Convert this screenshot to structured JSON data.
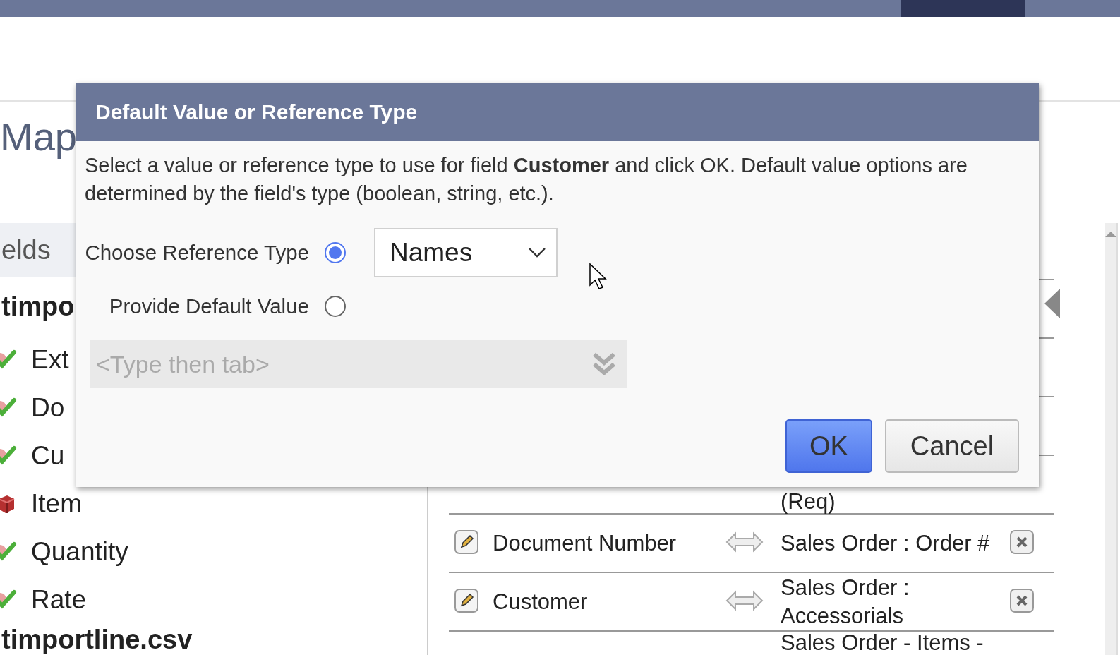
{
  "page": {
    "heading": "Map"
  },
  "fields_panel": {
    "header": "elds",
    "files": [
      {
        "name": "timpo",
        "fields": [
          {
            "label": "Ext",
            "mapped": true
          },
          {
            "label": "Do",
            "mapped": true
          },
          {
            "label": "Cu",
            "mapped": true
          },
          {
            "label": "Item",
            "mapped": false
          },
          {
            "label": "Quantity",
            "mapped": true
          },
          {
            "label": "Rate",
            "mapped": true
          }
        ]
      },
      {
        "name": "timportline.csv"
      }
    ]
  },
  "mappings": {
    "rows": [
      {
        "target": "(Req)"
      },
      {
        "source": "Document Number",
        "target": "Sales Order : Order #"
      },
      {
        "source": "Customer",
        "target": "Sales Order : Accessorials"
      },
      {
        "target": "Sales Order - Items -"
      }
    ]
  },
  "dialog": {
    "title": "Default Value or Reference Type",
    "message": "Select a value or reference type to use for field **Customer** and click OK. Default value options are determined by the field's type (boolean, string, etc.).",
    "options": [
      {
        "label": "Choose Reference Type",
        "selected": true,
        "kind": "select",
        "value": "Names"
      },
      {
        "label": "Provide Default Value",
        "selected": false,
        "kind": "plain"
      }
    ],
    "default_field": {
      "placeholder": "<Type then tab>",
      "disabled": true
    },
    "buttons": [
      {
        "label": "OK",
        "kind": "primary"
      },
      {
        "label": "Cancel",
        "kind": "secondary"
      }
    ]
  }
}
